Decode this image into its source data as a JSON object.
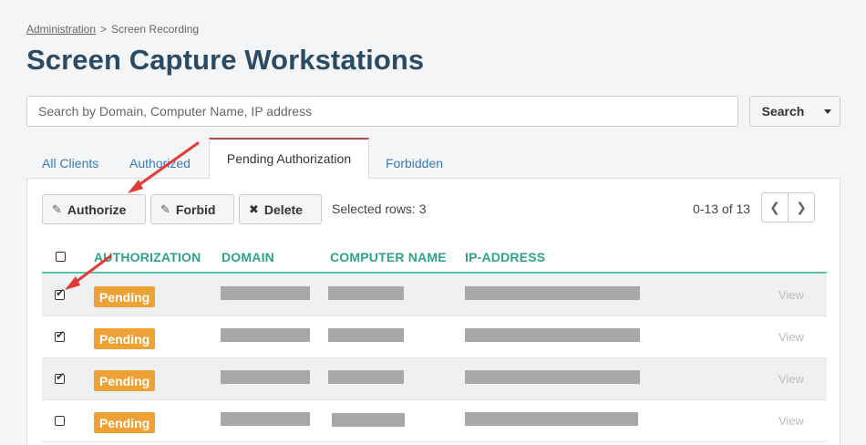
{
  "breadcrumb": {
    "parent": "Administration",
    "separator": ">",
    "current": "Screen Recording"
  },
  "page_title": "Screen Capture Workstations",
  "search": {
    "placeholder": "Search by Domain, Computer Name, IP address",
    "value": "",
    "button_label": "Search"
  },
  "tabs": [
    {
      "label": "All Clients",
      "active": false
    },
    {
      "label": "Authorized",
      "active": false
    },
    {
      "label": "Pending Authorization",
      "active": true
    },
    {
      "label": "Forbidden",
      "active": false
    }
  ],
  "toolbar": {
    "authorize_label": "Authorize",
    "forbid_label": "Forbid",
    "delete_label": "Delete",
    "selected_text": "Selected rows: 3",
    "range_text": "0-13 of 13",
    "prev_icon": "chevron-left-icon",
    "next_icon": "chevron-right-icon"
  },
  "table": {
    "columns": [
      "AUTHORIZATION",
      "DOMAIN",
      "COMPUTER NAME",
      "IP-ADDRESS"
    ],
    "rows": [
      {
        "checked": true,
        "status": "Pending",
        "action": "View"
      },
      {
        "checked": true,
        "status": "Pending",
        "action": "View"
      },
      {
        "checked": true,
        "status": "Pending",
        "action": "View"
      },
      {
        "checked": false,
        "status": "Pending",
        "action": "View"
      }
    ]
  },
  "colors": {
    "title": "#2b4a63",
    "tab_link": "#3a7bb5",
    "active_tab_border": "#b94a48",
    "header_text": "#2ea38a",
    "header_underline": "#59bfa6",
    "pending_badge": "#eea236",
    "annotation_arrow": "#e53935"
  }
}
